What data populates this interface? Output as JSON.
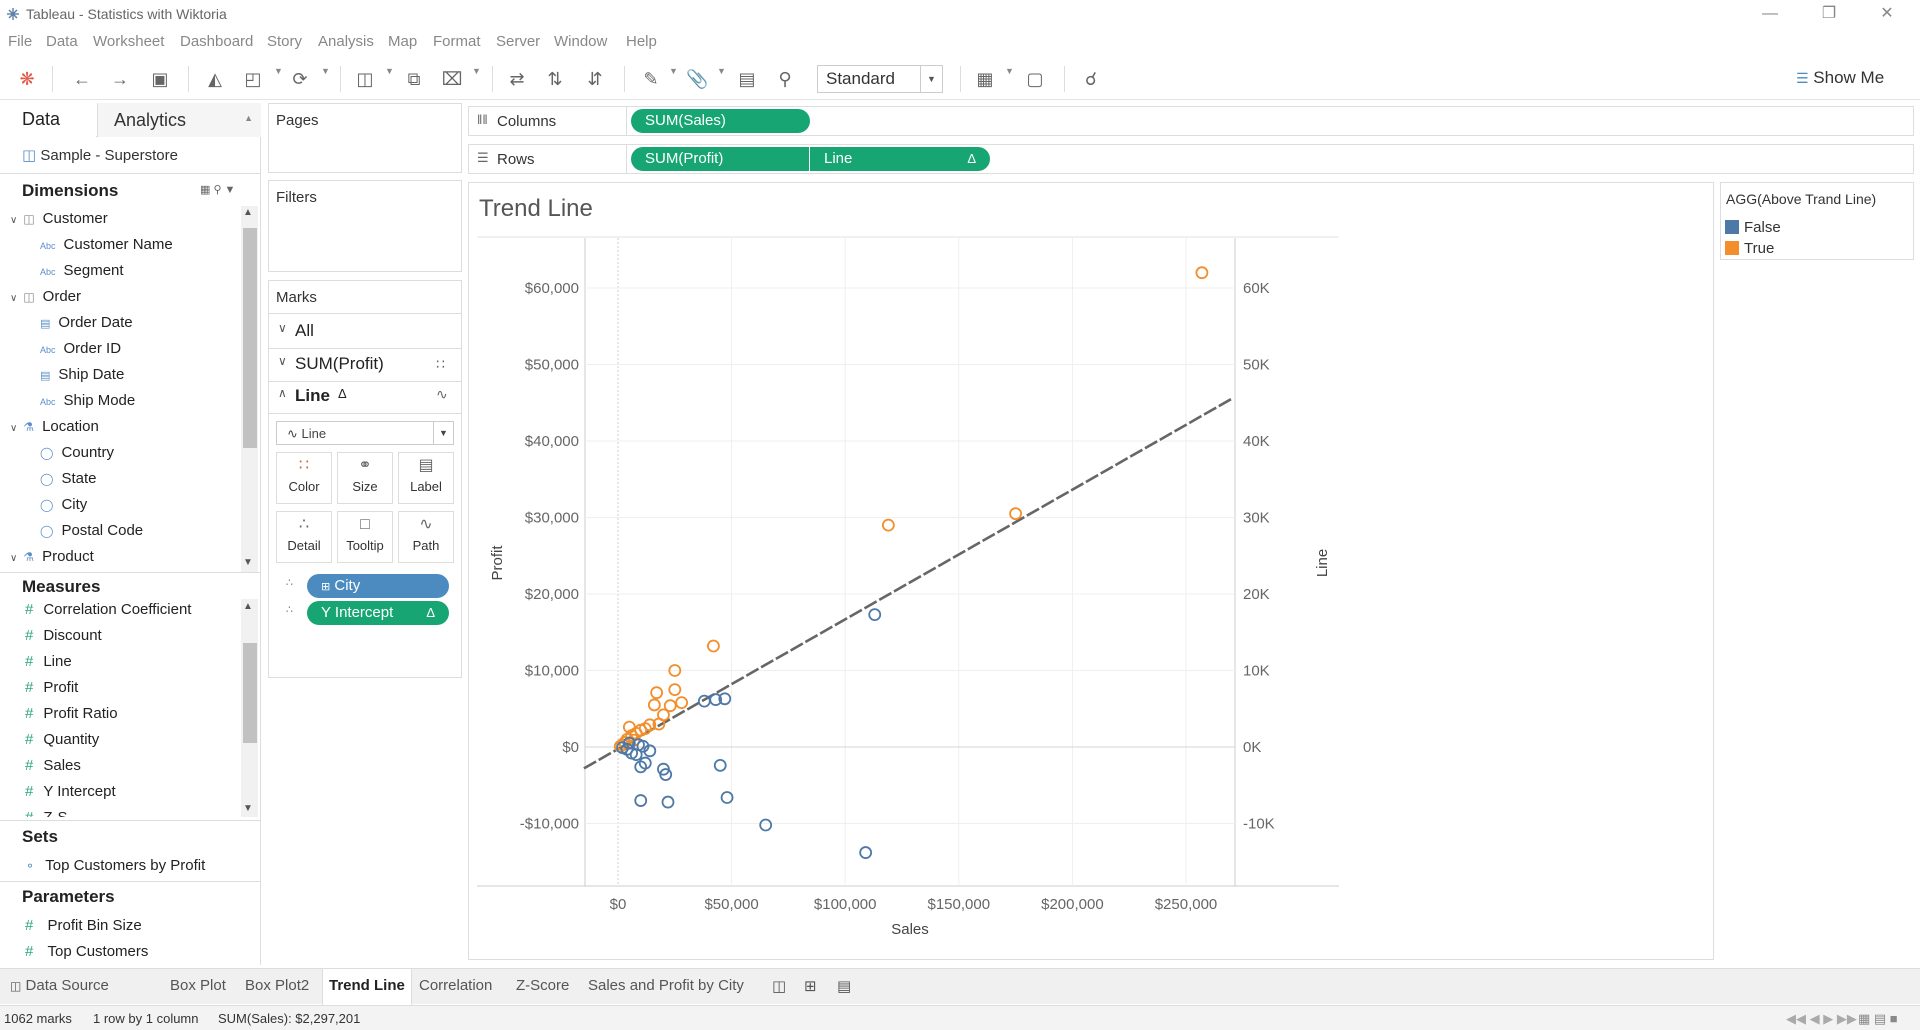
{
  "window": {
    "title": "Tableau - Statistics with Wiktoria"
  },
  "menu": [
    "File",
    "Data",
    "Worksheet",
    "Dashboard",
    "Story",
    "Analysis",
    "Map",
    "Format",
    "Server",
    "Window",
    "Help"
  ],
  "toolbar": {
    "fit_mode": "Standard",
    "show_me": "Show Me"
  },
  "datapane": {
    "tab_data": "Data",
    "tab_analytics": "Analytics",
    "datasource": "Sample - Superstore",
    "dimensions_header": "Dimensions",
    "dimensions": [
      {
        "label": "Customer",
        "kind": "folder"
      },
      {
        "label": "Customer Name",
        "kind": "abc"
      },
      {
        "label": "Segment",
        "kind": "abc"
      },
      {
        "label": "Order",
        "kind": "folder"
      },
      {
        "label": "Order Date",
        "kind": "date"
      },
      {
        "label": "Order ID",
        "kind": "abc"
      },
      {
        "label": "Ship Date",
        "kind": "date"
      },
      {
        "label": "Ship Mode",
        "kind": "abc"
      },
      {
        "label": "Location",
        "kind": "hier"
      },
      {
        "label": "Country",
        "kind": "geo"
      },
      {
        "label": "State",
        "kind": "geo"
      },
      {
        "label": "City",
        "kind": "geo"
      },
      {
        "label": "Postal Code",
        "kind": "geo"
      },
      {
        "label": "Product",
        "kind": "hier"
      }
    ],
    "measures_header": "Measures",
    "measures": [
      "Correlation Coefficient",
      "Discount",
      "Line",
      "Profit",
      "Profit Ratio",
      "Quantity",
      "Sales",
      "Y Intercept",
      "Z-S"
    ],
    "sets_header": "Sets",
    "sets": [
      "Top Customers by Profit"
    ],
    "parameters_header": "Parameters",
    "parameters": [
      "Profit Bin Size",
      "Top Customers"
    ]
  },
  "shelves": {
    "pages": "Pages",
    "filters": "Filters",
    "columns_label": "Columns",
    "rows_label": "Rows",
    "columns_pill": "SUM(Sales)",
    "rows_pill_1": "SUM(Profit)",
    "rows_pill_2": "Line",
    "delta": "Δ"
  },
  "marks": {
    "title": "Marks",
    "all": "All",
    "sum_profit": "SUM(Profit)",
    "line": "Line",
    "mark_type": "Line",
    "buttons": [
      "Color",
      "Size",
      "Label",
      "Detail",
      "Tooltip",
      "Path"
    ],
    "pill_city": "City",
    "pill_yint": "Y Intercept"
  },
  "legend": {
    "title": "AGG(Above Trand Line)",
    "items": [
      {
        "label": "False",
        "color": "#4e79a7"
      },
      {
        "label": "True",
        "color": "#f28e2b"
      }
    ]
  },
  "chart_data": {
    "type": "scatter",
    "title": "Trend Line",
    "xlabel": "Sales",
    "ylabel": "Profit",
    "ylabel_right": "Line",
    "xlim": [
      -15000,
      270000
    ],
    "ylim": [
      -16000,
      66000
    ],
    "x_ticks": [
      "$0",
      "$50,000",
      "$100,000",
      "$150,000",
      "$200,000",
      "$250,000"
    ],
    "y_ticks": [
      "$60,000",
      "$50,000",
      "$40,000",
      "$30,000",
      "$20,000",
      "$10,000",
      "$0",
      "-$10,000"
    ],
    "y2_ticks": [
      "60K",
      "50K",
      "40K",
      "30K",
      "20K",
      "10K",
      "0K",
      "-10K"
    ],
    "trend_line": {
      "x": [
        -15000,
        270000
      ],
      "y": [
        -2800,
        45500
      ]
    },
    "series": [
      {
        "name": "True",
        "color": "#f28e2b",
        "points": [
          [
            257000,
            62000
          ],
          [
            175000,
            30500
          ],
          [
            119000,
            29000
          ],
          [
            42000,
            13200
          ],
          [
            25000,
            10000
          ],
          [
            17000,
            7100
          ],
          [
            25000,
            7500
          ],
          [
            16000,
            5500
          ],
          [
            23000,
            5400
          ],
          [
            28000,
            5800
          ],
          [
            20000,
            4200
          ],
          [
            18000,
            3000
          ],
          [
            12000,
            2400
          ],
          [
            10000,
            2200
          ],
          [
            8000,
            1800
          ],
          [
            6000,
            1500
          ],
          [
            4000,
            1000
          ],
          [
            3000,
            600
          ],
          [
            2000,
            300
          ],
          [
            1000,
            100
          ],
          [
            5000,
            2600
          ],
          [
            7000,
            900
          ],
          [
            14000,
            2900
          ]
        ]
      },
      {
        "name": "False",
        "color": "#4e79a7",
        "points": [
          [
            113000,
            17300
          ],
          [
            38000,
            6000
          ],
          [
            43000,
            6200
          ],
          [
            47000,
            6300
          ],
          [
            45000,
            -2400
          ],
          [
            48000,
            -6600
          ],
          [
            20000,
            -2900
          ],
          [
            21000,
            -3600
          ],
          [
            10000,
            -7000
          ],
          [
            22000,
            -7200
          ],
          [
            65000,
            -10200
          ],
          [
            109000,
            -13800
          ],
          [
            10000,
            -2600
          ],
          [
            12000,
            -2100
          ],
          [
            14000,
            -500
          ],
          [
            8000,
            -1000
          ],
          [
            6000,
            -800
          ],
          [
            4000,
            -300
          ],
          [
            2000,
            -100
          ],
          [
            9000,
            300
          ],
          [
            5000,
            500
          ],
          [
            11000,
            100
          ]
        ]
      }
    ]
  },
  "sheets": {
    "datasource": "Data Source",
    "tabs": [
      "Box Plot",
      "Box Plot2",
      "Trend Line",
      "Correlation",
      "Z-Score",
      "Sales and Profit by City"
    ]
  },
  "status": {
    "marks": "1062 marks",
    "rows_cols": "1 row by 1 column",
    "sum": "SUM(Sales): $2,297,201"
  }
}
